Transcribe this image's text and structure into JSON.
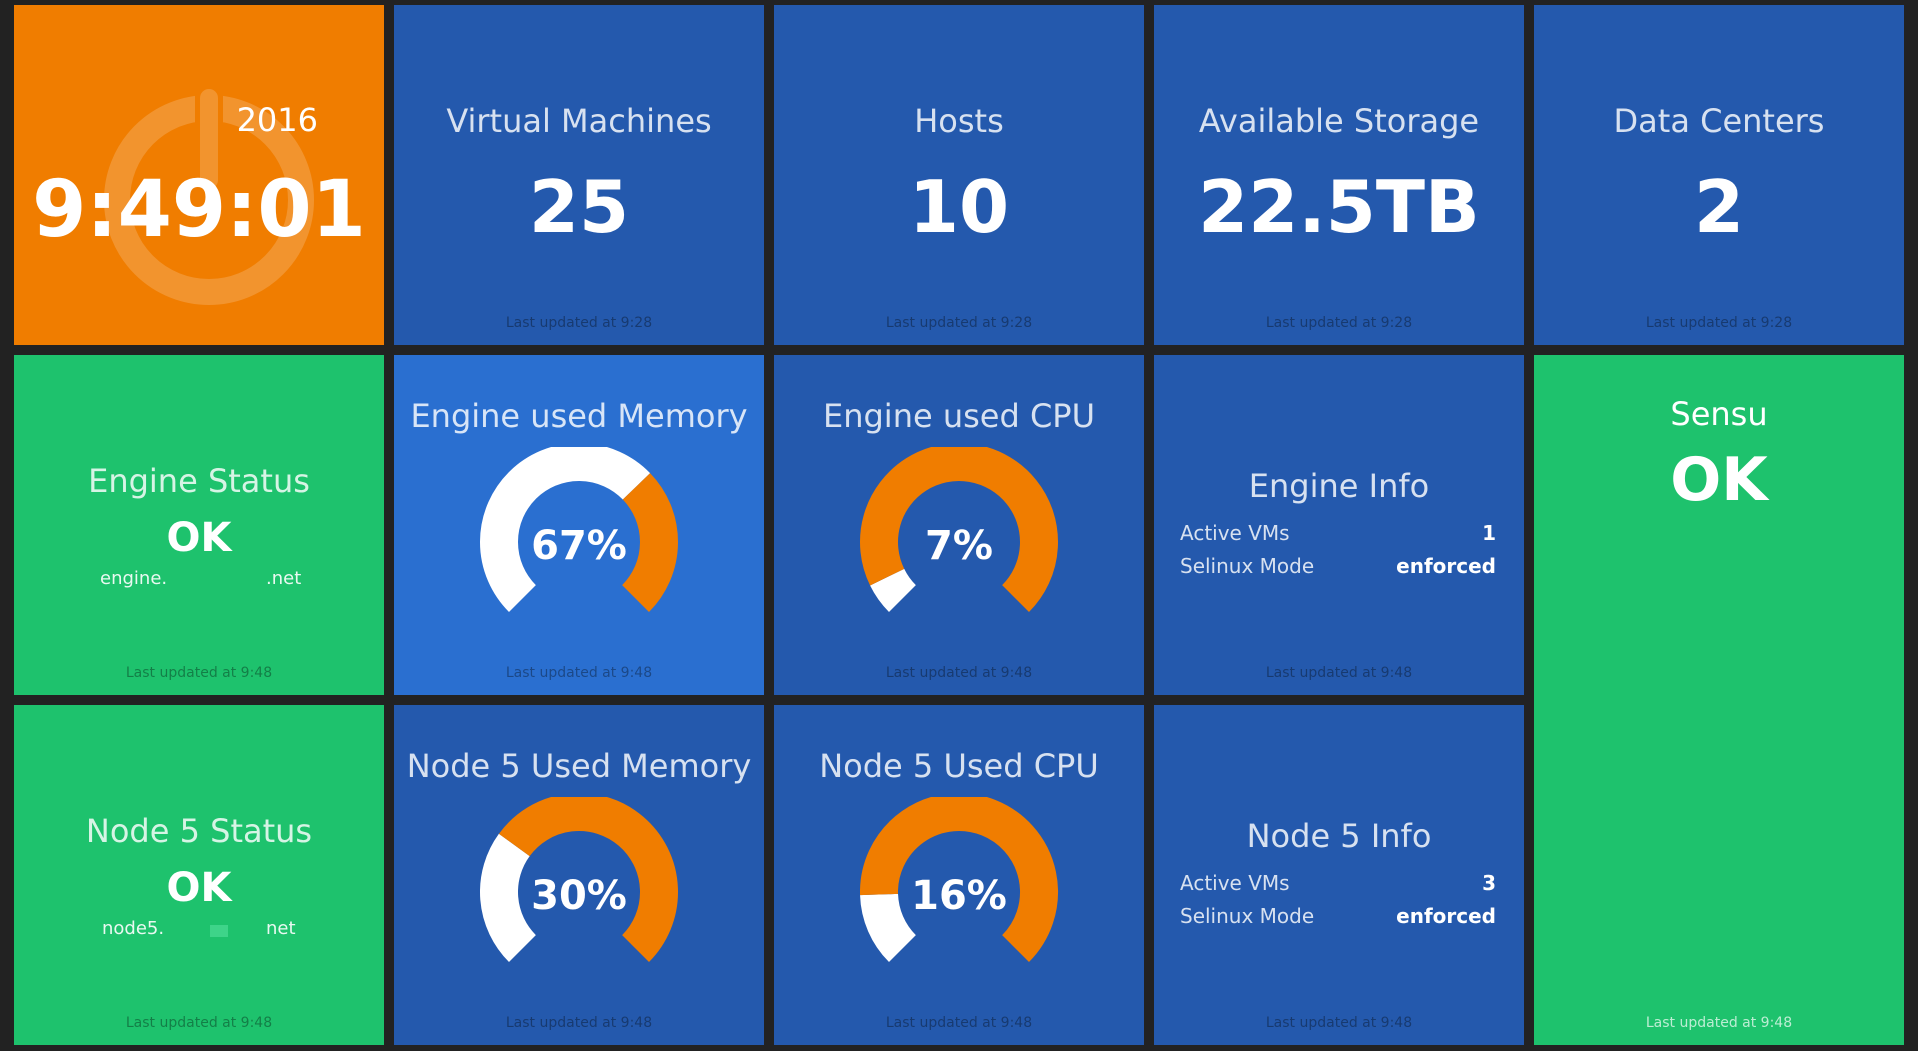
{
  "colors": {
    "background": "#222222",
    "tile_blue": "#2459ad",
    "tile_blue_active": "#2a6fd0",
    "tile_green": "#1ec26d",
    "tile_orange": "#f07d00",
    "gauge_fill": "#f07d00",
    "gauge_track": "#ffffff"
  },
  "clock": {
    "year": "2016",
    "time": "9:49:01",
    "icon": "power-icon"
  },
  "virtual_machines": {
    "title": "Virtual Machines",
    "value": "25",
    "updated": "Last updated at 9:28"
  },
  "hosts": {
    "title": "Hosts",
    "value": "10",
    "updated": "Last updated at 9:28"
  },
  "available_storage": {
    "title": "Available Storage",
    "value": "22.5TB",
    "updated": "Last updated at 9:28"
  },
  "data_centers": {
    "title": "Data Centers",
    "value": "2",
    "updated": "Last updated at 9:28"
  },
  "engine_status": {
    "title": "Engine Status",
    "status": "OK",
    "host_prefix": "engine.",
    "host_suffix": ".net",
    "updated": "Last updated at 9:48"
  },
  "engine_memory": {
    "title": "Engine used Memory",
    "percent": 67,
    "label": "67%",
    "updated": "Last updated at 9:48"
  },
  "engine_cpu": {
    "title": "Engine used CPU",
    "percent": 7,
    "label": "7%",
    "updated": "Last updated at 9:48"
  },
  "engine_info": {
    "title": "Engine Info",
    "rows": [
      {
        "key": "Active VMs",
        "value": "1"
      },
      {
        "key": "Selinux Mode",
        "value": "enforced"
      }
    ],
    "updated": "Last updated at 9:48"
  },
  "sensu": {
    "title": "Sensu",
    "status": "OK",
    "updated": "Last updated at 9:48"
  },
  "node5_status": {
    "title": "Node 5 Status",
    "status": "OK",
    "host_prefix": "node5.",
    "host_suffix": "net",
    "updated": "Last updated at 9:48"
  },
  "node5_memory": {
    "title": "Node 5 Used Memory",
    "percent": 30,
    "label": "30%",
    "updated": "Last updated at 9:48"
  },
  "node5_cpu": {
    "title": "Node 5 Used CPU",
    "percent": 16,
    "label": "16%",
    "updated": "Last updated at 9:48"
  },
  "node5_info": {
    "title": "Node 5 Info",
    "rows": [
      {
        "key": "Active VMs",
        "value": "3"
      },
      {
        "key": "Selinux Mode",
        "value": "enforced"
      }
    ],
    "updated": "Last updated at 9:48"
  }
}
